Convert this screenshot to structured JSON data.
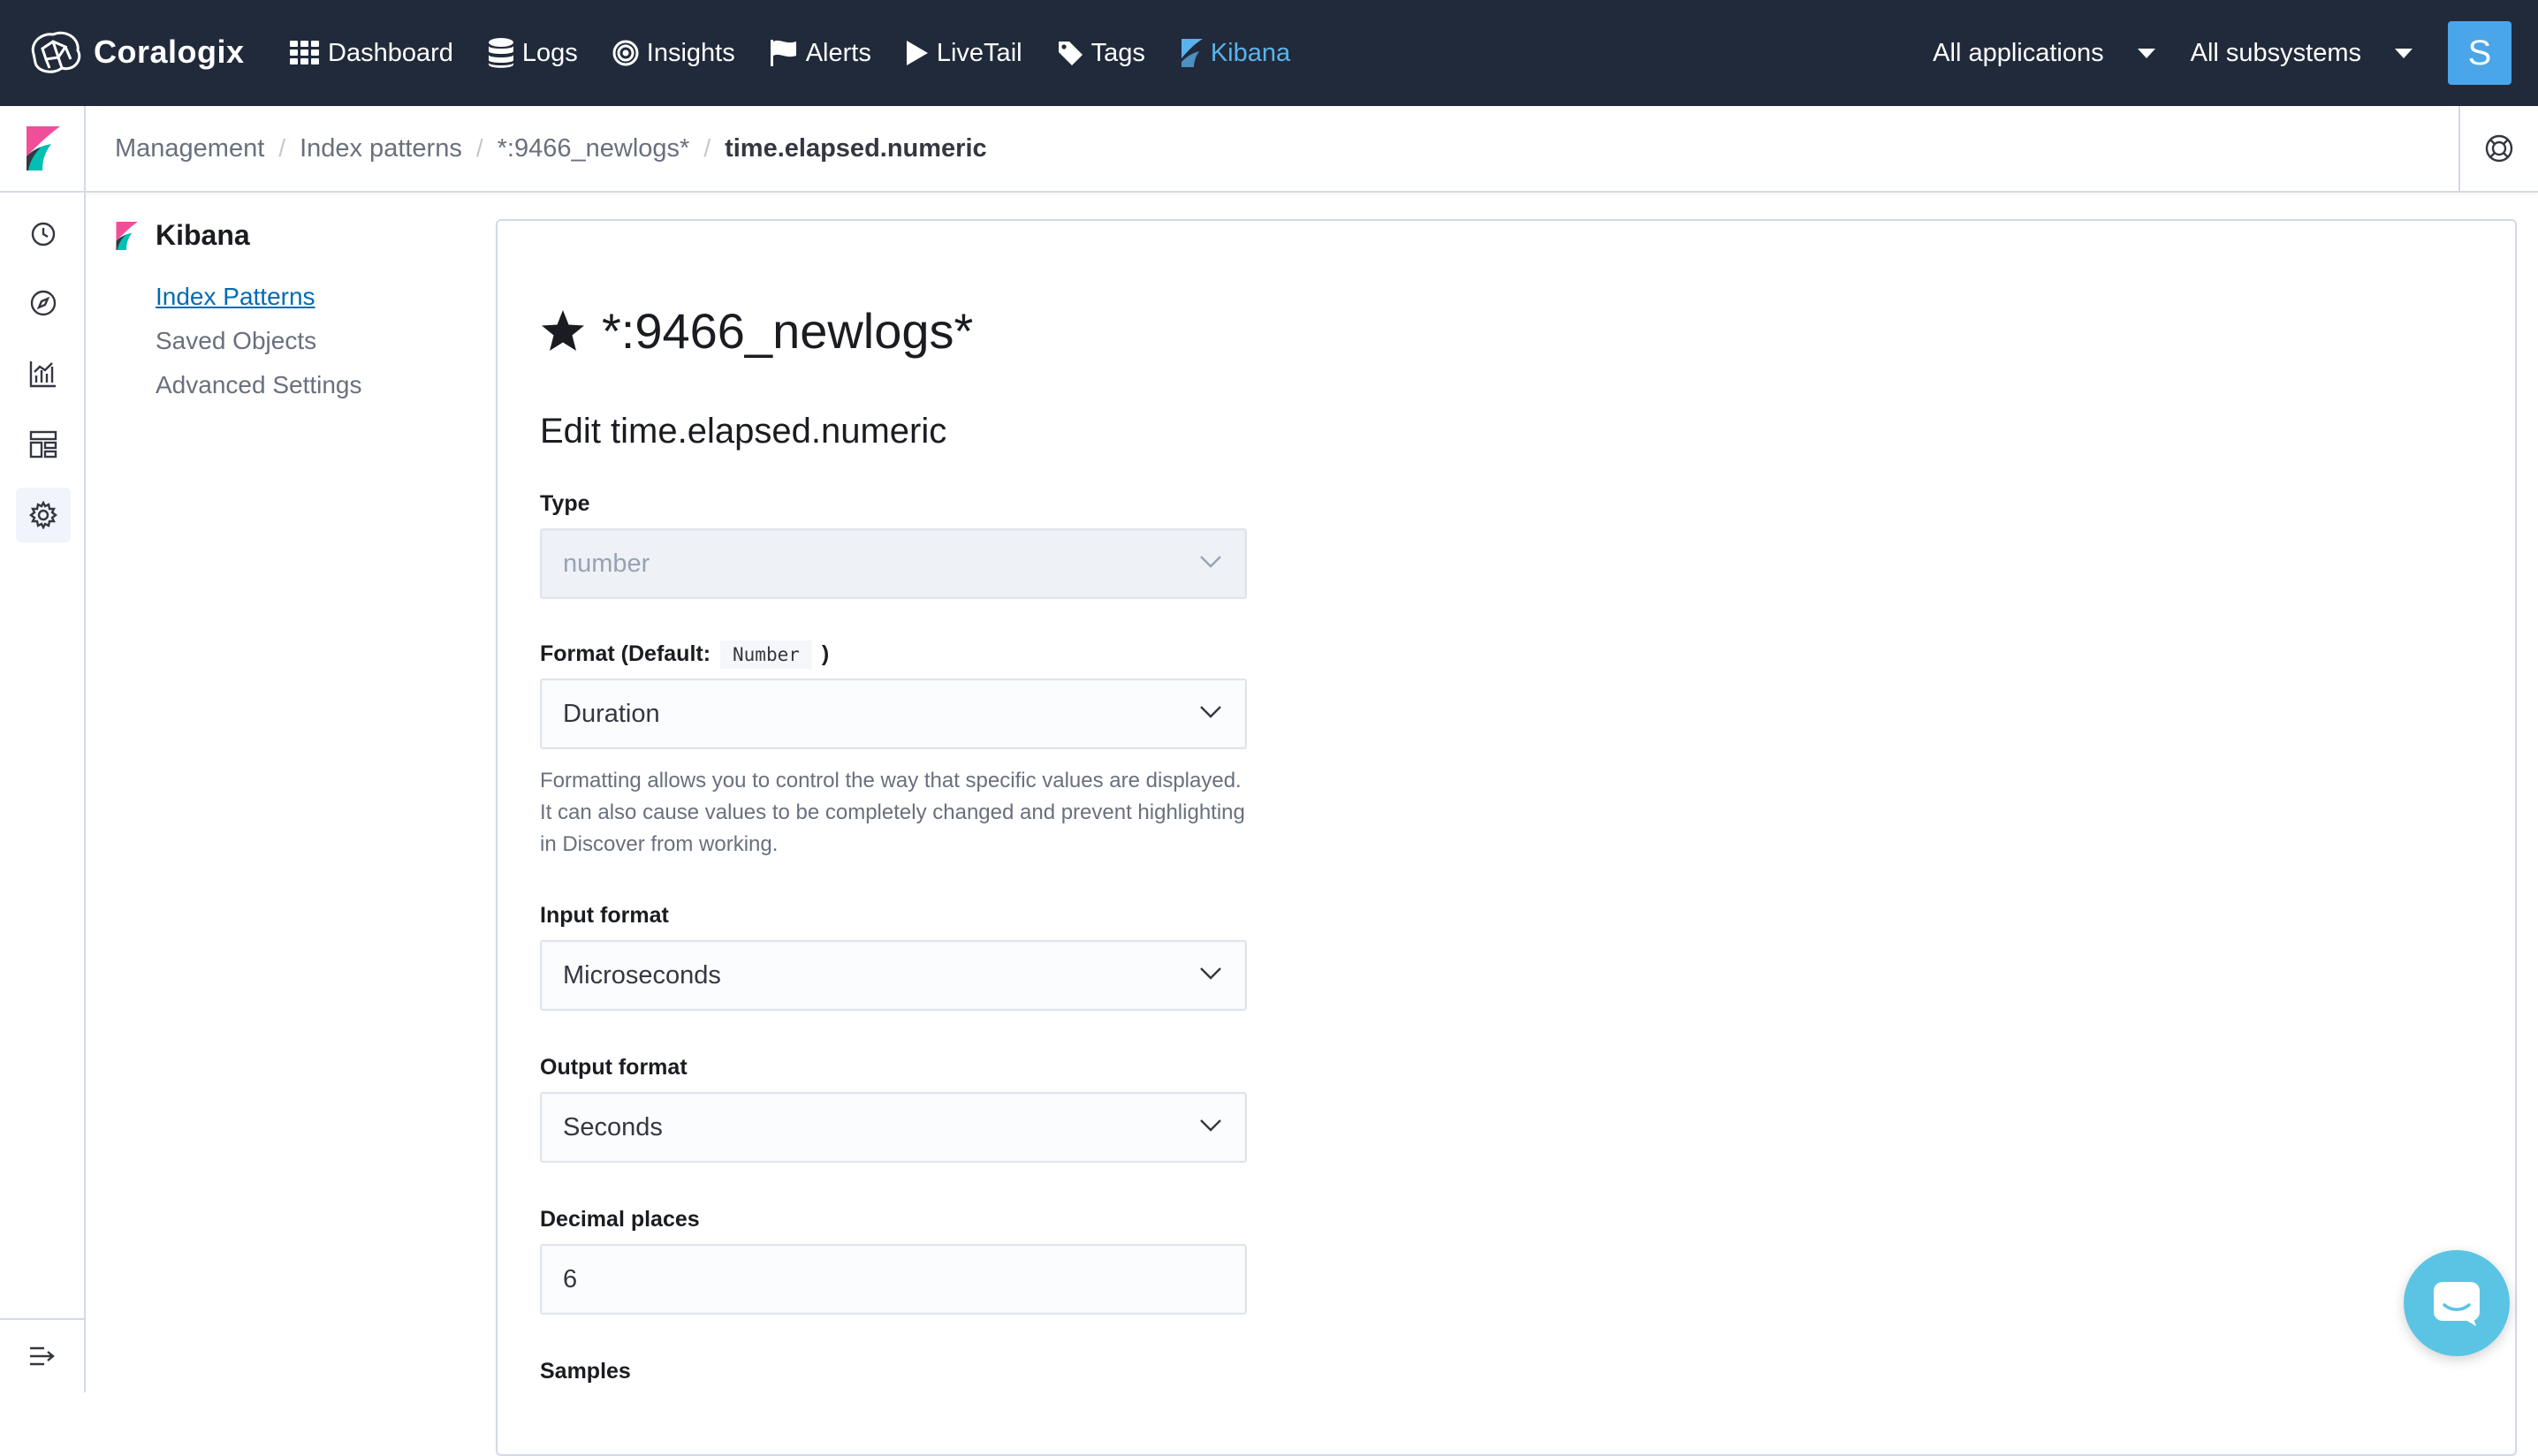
{
  "topnav": {
    "brand": "Coralogix",
    "items": [
      {
        "label": "Dashboard",
        "icon": "grid-icon"
      },
      {
        "label": "Logs",
        "icon": "database-icon"
      },
      {
        "label": "Insights",
        "icon": "insights-icon"
      },
      {
        "label": "Alerts",
        "icon": "flag-icon"
      },
      {
        "label": "LiveTail",
        "icon": "play-icon"
      },
      {
        "label": "Tags",
        "icon": "tag-icon"
      },
      {
        "label": "Kibana",
        "icon": "kibana-icon",
        "active": true
      }
    ],
    "app_select": "All applications",
    "subsystem_select": "All subsystems",
    "avatar_letter": "S"
  },
  "breadcrumb": {
    "items": [
      "Management",
      "Index patterns",
      "*:9466_newlogs*"
    ],
    "current": "time.elapsed.numeric"
  },
  "sidenav": {
    "title": "Kibana",
    "links": [
      {
        "label": "Index Patterns",
        "active": true
      },
      {
        "label": "Saved Objects",
        "active": false
      },
      {
        "label": "Advanced Settings",
        "active": false
      }
    ]
  },
  "main": {
    "pattern_title": "*:9466_newlogs*",
    "edit_title": "Edit time.elapsed.numeric",
    "type_label": "Type",
    "type_value": "number",
    "format_label_prefix": "Format (Default:",
    "format_default_code": "Number",
    "format_label_suffix": ")",
    "format_value": "Duration",
    "format_help": "Formatting allows you to control the way that specific values are displayed. It can also cause values to be completely changed and prevent highlighting in Discover from working.",
    "input_format_label": "Input format",
    "input_format_value": "Microseconds",
    "output_format_label": "Output format",
    "output_format_value": "Seconds",
    "decimal_places_label": "Decimal places",
    "decimal_places_value": "6",
    "samples_label": "Samples"
  },
  "colors": {
    "nav_bg": "#202a3a",
    "kibana_active": "#5ab3ec",
    "link": "#006bb4",
    "chat": "#5bc4e4"
  }
}
